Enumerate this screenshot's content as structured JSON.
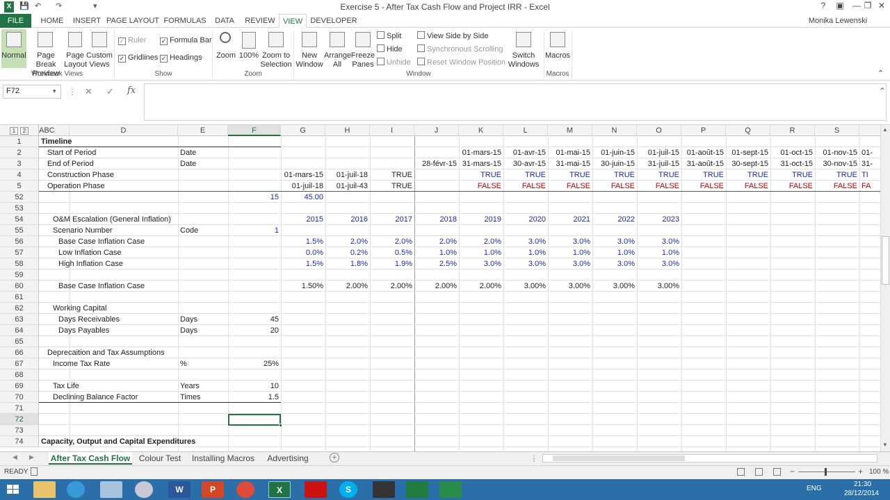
{
  "window": {
    "title": "Exercise 5 - After Tax Cash Flow and Project IRR - Excel",
    "user": "Monika Lewenski"
  },
  "tabs": [
    "FILE",
    "HOME",
    "INSERT",
    "PAGE LAYOUT",
    "FORMULAS",
    "DATA",
    "REVIEW",
    "VIEW",
    "DEVELOPER"
  ],
  "ribbon": {
    "normal": "Normal",
    "page_break": "Page Break Preview",
    "page_layout": "Page Layout",
    "custom_views": "Custom Views",
    "workbook_views": "Workbook Views",
    "ruler": "Ruler",
    "formula_bar": "Formula Bar",
    "gridlines": "Gridlines",
    "headings": "Headings",
    "show": "Show",
    "zoom": "Zoom",
    "zoom100": "100%",
    "zoom_sel": "Zoom to Selection",
    "zoom_grp": "Zoom",
    "new_window": "New Window",
    "arrange_all": "Arrange All",
    "freeze_panes": "Freeze Panes",
    "split": "Split",
    "hide": "Hide",
    "unhide": "Unhide",
    "view_side": "View Side by Side",
    "sync_scroll": "Synchronous Scrolling",
    "reset_pos": "Reset Window Position",
    "switch_windows": "Switch Windows",
    "window_grp": "Window",
    "macros": "Macros",
    "macros_grp": "Macros"
  },
  "namebox": "F72",
  "columns": [
    "ABC",
    "D",
    "E",
    "F",
    "G",
    "H",
    "I",
    "J",
    "K",
    "L",
    "M",
    "N",
    "O",
    "P",
    "Q",
    "R",
    "S"
  ],
  "rows": [
    {
      "n": "1",
      "cells": [
        {
          "c": "ABC",
          "t": "Timeline",
          "b": true
        }
      ]
    },
    {
      "n": "2",
      "cells": [
        {
          "c": "ABC",
          "t": "Start of Period",
          "i": 1
        },
        {
          "c": "E",
          "t": "Date"
        },
        {
          "c": "K",
          "t": "01-mars-15",
          "a": "r"
        },
        {
          "c": "L",
          "t": "01-avr-15",
          "a": "r"
        },
        {
          "c": "M",
          "t": "01-mai-15",
          "a": "r"
        },
        {
          "c": "N",
          "t": "01-juin-15",
          "a": "r"
        },
        {
          "c": "O",
          "t": "01-juil-15",
          "a": "r"
        },
        {
          "c": "P",
          "t": "01-août-15",
          "a": "r"
        },
        {
          "c": "Q",
          "t": "01-sept-15",
          "a": "r"
        },
        {
          "c": "R",
          "t": "01-oct-15",
          "a": "r"
        },
        {
          "c": "S",
          "t": "01-nov-15",
          "a": "r"
        },
        {
          "c": "T",
          "t": "01-"
        }
      ]
    },
    {
      "n": "3",
      "cells": [
        {
          "c": "ABC",
          "t": "End of Period",
          "i": 1
        },
        {
          "c": "E",
          "t": "Date"
        },
        {
          "c": "J",
          "t": "28-févr-15",
          "a": "r"
        },
        {
          "c": "K",
          "t": "31-mars-15",
          "a": "r"
        },
        {
          "c": "L",
          "t": "30-avr-15",
          "a": "r"
        },
        {
          "c": "M",
          "t": "31-mai-15",
          "a": "r"
        },
        {
          "c": "N",
          "t": "30-juin-15",
          "a": "r"
        },
        {
          "c": "O",
          "t": "31-juil-15",
          "a": "r"
        },
        {
          "c": "P",
          "t": "31-août-15",
          "a": "r"
        },
        {
          "c": "Q",
          "t": "30-sept-15",
          "a": "r"
        },
        {
          "c": "R",
          "t": "31-oct-15",
          "a": "r"
        },
        {
          "c": "S",
          "t": "30-nov-15",
          "a": "r"
        },
        {
          "c": "T",
          "t": "31-"
        }
      ]
    },
    {
      "n": "4",
      "cells": [
        {
          "c": "ABC",
          "t": "Construction Phase",
          "i": 1
        },
        {
          "c": "G",
          "t": "01-mars-15",
          "a": "r"
        },
        {
          "c": "H",
          "t": "01-juil-18",
          "a": "r"
        },
        {
          "c": "I",
          "t": "TRUE",
          "a": "r"
        },
        {
          "c": "K",
          "t": "TRUE",
          "a": "r",
          "k": "blue"
        },
        {
          "c": "L",
          "t": "TRUE",
          "a": "r",
          "k": "blue"
        },
        {
          "c": "M",
          "t": "TRUE",
          "a": "r",
          "k": "blue"
        },
        {
          "c": "N",
          "t": "TRUE",
          "a": "r",
          "k": "blue"
        },
        {
          "c": "O",
          "t": "TRUE",
          "a": "r",
          "k": "blue"
        },
        {
          "c": "P",
          "t": "TRUE",
          "a": "r",
          "k": "blue"
        },
        {
          "c": "Q",
          "t": "TRUE",
          "a": "r",
          "k": "blue"
        },
        {
          "c": "R",
          "t": "TRUE",
          "a": "r",
          "k": "blue"
        },
        {
          "c": "S",
          "t": "TRUE",
          "a": "r",
          "k": "blue"
        },
        {
          "c": "T",
          "t": "TI",
          "k": "blue"
        }
      ]
    },
    {
      "n": "5",
      "cells": [
        {
          "c": "ABC",
          "t": "Operation Phase",
          "i": 1
        },
        {
          "c": "G",
          "t": "01-juil-18",
          "a": "r"
        },
        {
          "c": "H",
          "t": "01-juil-43",
          "a": "r"
        },
        {
          "c": "I",
          "t": "TRUE",
          "a": "r"
        },
        {
          "c": "K",
          "t": "FALSE",
          "a": "r",
          "k": "red"
        },
        {
          "c": "L",
          "t": "FALSE",
          "a": "r",
          "k": "red"
        },
        {
          "c": "M",
          "t": "FALSE",
          "a": "r",
          "k": "red"
        },
        {
          "c": "N",
          "t": "FALSE",
          "a": "r",
          "k": "red"
        },
        {
          "c": "O",
          "t": "FALSE",
          "a": "r",
          "k": "red"
        },
        {
          "c": "P",
          "t": "FALSE",
          "a": "r",
          "k": "red"
        },
        {
          "c": "Q",
          "t": "FALSE",
          "a": "r",
          "k": "red"
        },
        {
          "c": "R",
          "t": "FALSE",
          "a": "r",
          "k": "red"
        },
        {
          "c": "S",
          "t": "FALSE",
          "a": "r",
          "k": "red"
        },
        {
          "c": "T",
          "t": "FA",
          "k": "red"
        }
      ]
    },
    {
      "n": "52",
      "cells": [
        {
          "c": "F",
          "t": "15",
          "a": "r",
          "k": "blue"
        },
        {
          "c": "G",
          "t": "45.00",
          "a": "r",
          "k": "blue"
        }
      ]
    },
    {
      "n": "53",
      "cells": []
    },
    {
      "n": "54",
      "cells": [
        {
          "c": "ABC",
          "t": "O&M Escalation (General Inflation)",
          "i": 2
        },
        {
          "c": "G",
          "t": "2015",
          "a": "r",
          "k": "blue"
        },
        {
          "c": "H",
          "t": "2016",
          "a": "r",
          "k": "blue"
        },
        {
          "c": "I",
          "t": "2017",
          "a": "r",
          "k": "blue"
        },
        {
          "c": "J",
          "t": "2018",
          "a": "r",
          "k": "blue"
        },
        {
          "c": "K",
          "t": "2019",
          "a": "r",
          "k": "blue"
        },
        {
          "c": "L",
          "t": "2020",
          "a": "r",
          "k": "blue"
        },
        {
          "c": "M",
          "t": "2021",
          "a": "r",
          "k": "blue"
        },
        {
          "c": "N",
          "t": "2022",
          "a": "r",
          "k": "blue"
        },
        {
          "c": "O",
          "t": "2023",
          "a": "r",
          "k": "blue"
        }
      ]
    },
    {
      "n": "55",
      "cells": [
        {
          "c": "ABC",
          "t": "Scenario Number",
          "i": 2
        },
        {
          "c": "E",
          "t": "Code"
        },
        {
          "c": "F",
          "t": "1",
          "a": "r",
          "k": "blue"
        }
      ]
    },
    {
      "n": "56",
      "cells": [
        {
          "c": "ABC",
          "t": "Base Case Inflation Case",
          "i": 3
        },
        {
          "c": "G",
          "t": "1.5%",
          "a": "r",
          "k": "blue"
        },
        {
          "c": "H",
          "t": "2.0%",
          "a": "r",
          "k": "blue"
        },
        {
          "c": "I",
          "t": "2.0%",
          "a": "r",
          "k": "blue"
        },
        {
          "c": "J",
          "t": "2.0%",
          "a": "r",
          "k": "blue"
        },
        {
          "c": "K",
          "t": "2.0%",
          "a": "r",
          "k": "blue"
        },
        {
          "c": "L",
          "t": "3.0%",
          "a": "r",
          "k": "blue"
        },
        {
          "c": "M",
          "t": "3.0%",
          "a": "r",
          "k": "blue"
        },
        {
          "c": "N",
          "t": "3.0%",
          "a": "r",
          "k": "blue"
        },
        {
          "c": "O",
          "t": "3.0%",
          "a": "r",
          "k": "blue"
        }
      ]
    },
    {
      "n": "57",
      "cells": [
        {
          "c": "ABC",
          "t": "Low Inflation Case",
          "i": 3
        },
        {
          "c": "G",
          "t": "0.0%",
          "a": "r",
          "k": "blue"
        },
        {
          "c": "H",
          "t": "0.2%",
          "a": "r",
          "k": "blue"
        },
        {
          "c": "I",
          "t": "0.5%",
          "a": "r",
          "k": "blue"
        },
        {
          "c": "J",
          "t": "1.0%",
          "a": "r",
          "k": "blue"
        },
        {
          "c": "K",
          "t": "1.0%",
          "a": "r",
          "k": "blue"
        },
        {
          "c": "L",
          "t": "1.0%",
          "a": "r",
          "k": "blue"
        },
        {
          "c": "M",
          "t": "1.0%",
          "a": "r",
          "k": "blue"
        },
        {
          "c": "N",
          "t": "1.0%",
          "a": "r",
          "k": "blue"
        },
        {
          "c": "O",
          "t": "1.0%",
          "a": "r",
          "k": "blue"
        }
      ]
    },
    {
      "n": "58",
      "cells": [
        {
          "c": "ABC",
          "t": "High Inflation Case",
          "i": 3
        },
        {
          "c": "G",
          "t": "1.5%",
          "a": "r",
          "k": "blue"
        },
        {
          "c": "H",
          "t": "1.8%",
          "a": "r",
          "k": "blue"
        },
        {
          "c": "I",
          "t": "1.9%",
          "a": "r",
          "k": "blue"
        },
        {
          "c": "J",
          "t": "2.5%",
          "a": "r",
          "k": "blue"
        },
        {
          "c": "K",
          "t": "3.0%",
          "a": "r",
          "k": "blue"
        },
        {
          "c": "L",
          "t": "3.0%",
          "a": "r",
          "k": "blue"
        },
        {
          "c": "M",
          "t": "3.0%",
          "a": "r",
          "k": "blue"
        },
        {
          "c": "N",
          "t": "3.0%",
          "a": "r",
          "k": "blue"
        },
        {
          "c": "O",
          "t": "3.0%",
          "a": "r",
          "k": "blue"
        }
      ]
    },
    {
      "n": "59",
      "cells": []
    },
    {
      "n": "60",
      "cells": [
        {
          "c": "ABC",
          "t": "Base Case Inflation Case",
          "i": 3
        },
        {
          "c": "G",
          "t": "1.50%",
          "a": "r"
        },
        {
          "c": "H",
          "t": "2.00%",
          "a": "r"
        },
        {
          "c": "I",
          "t": "2.00%",
          "a": "r"
        },
        {
          "c": "J",
          "t": "2.00%",
          "a": "r"
        },
        {
          "c": "K",
          "t": "2.00%",
          "a": "r"
        },
        {
          "c": "L",
          "t": "3.00%",
          "a": "r"
        },
        {
          "c": "M",
          "t": "3.00%",
          "a": "r"
        },
        {
          "c": "N",
          "t": "3.00%",
          "a": "r"
        },
        {
          "c": "O",
          "t": "3.00%",
          "a": "r"
        }
      ]
    },
    {
      "n": "61",
      "cells": []
    },
    {
      "n": "62",
      "cells": [
        {
          "c": "ABC",
          "t": "Working Capital",
          "i": 2
        }
      ]
    },
    {
      "n": "63",
      "cells": [
        {
          "c": "ABC",
          "t": "Days Receivables",
          "i": 3
        },
        {
          "c": "E",
          "t": "Days"
        },
        {
          "c": "F",
          "t": "45",
          "a": "r"
        }
      ]
    },
    {
      "n": "64",
      "cells": [
        {
          "c": "ABC",
          "t": "Days Payables",
          "i": 3
        },
        {
          "c": "E",
          "t": "Days"
        },
        {
          "c": "F",
          "t": "20",
          "a": "r"
        }
      ]
    },
    {
      "n": "65",
      "cells": []
    },
    {
      "n": "66",
      "cells": [
        {
          "c": "ABC",
          "t": "Deprecaition and Tax Assumptions",
          "i": 1
        }
      ]
    },
    {
      "n": "67",
      "cells": [
        {
          "c": "ABC",
          "t": "Income Tax Rate",
          "i": 2
        },
        {
          "c": "E",
          "t": "%"
        },
        {
          "c": "F",
          "t": "25%",
          "a": "r"
        }
      ]
    },
    {
      "n": "68",
      "cells": []
    },
    {
      "n": "69",
      "cells": [
        {
          "c": "ABC",
          "t": "Tax Life",
          "i": 2
        },
        {
          "c": "E",
          "t": "Years"
        },
        {
          "c": "F",
          "t": "10",
          "a": "r"
        }
      ]
    },
    {
      "n": "70",
      "cells": [
        {
          "c": "ABC",
          "t": "Declining Balance Factor",
          "i": 2
        },
        {
          "c": "E",
          "t": "Times"
        },
        {
          "c": "F",
          "t": "1.5",
          "a": "r"
        }
      ]
    },
    {
      "n": "71",
      "cells": []
    },
    {
      "n": "72",
      "cells": []
    },
    {
      "n": "73",
      "cells": []
    },
    {
      "n": "74",
      "cells": [
        {
          "c": "ABC",
          "t": "Capacity, Output and Capital Expenditures",
          "b": true
        }
      ]
    }
  ],
  "sheets": [
    "After Tax Cash Flow",
    "Colour Test",
    "Installing Macros",
    "Advertising"
  ],
  "status": {
    "mode": "READY",
    "zoom": "100 %"
  },
  "taskbar": {
    "time": "21:30",
    "date": "28/12/2014",
    "lang": "ENG"
  },
  "colors": {
    "excel_green": "#217346",
    "blue_values": "#1f1fb0",
    "red_values": "#c00000"
  }
}
